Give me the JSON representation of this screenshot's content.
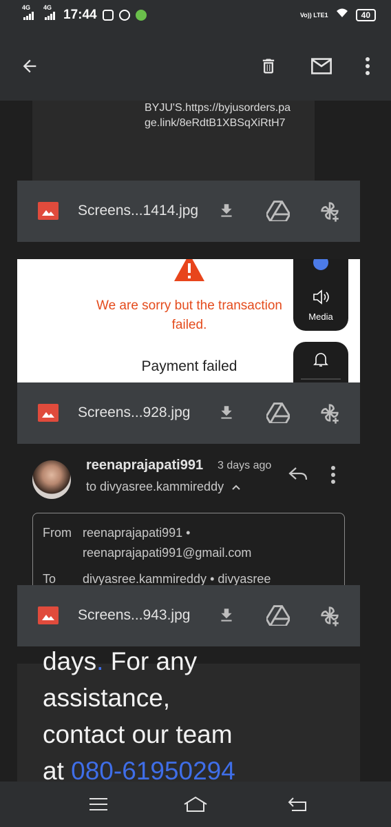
{
  "status_bar": {
    "network1": "4G",
    "network2": "4G",
    "time": "17:44",
    "volte": "Vo)) LTE1",
    "battery": "40"
  },
  "app_bar": {
    "back_icon": "arrow-left-icon",
    "delete_icon": "trash-icon",
    "mark_unread_icon": "envelope-icon",
    "more_icon": "more-vert-icon"
  },
  "message1": {
    "link_text": "BYJU'S.https://byjusorders.page.link/8eRdtB1XBSqXiRtH7"
  },
  "attachments": [
    {
      "filename": "Screens...1414.jpg"
    },
    {
      "filename": "Screens...928.jpg"
    },
    {
      "filename": "Screens...943.jpg"
    }
  ],
  "preview": {
    "fail_message": "We are sorry but the transaction failed.",
    "title": "Payment failed"
  },
  "volume_panel": {
    "media_label": "Media"
  },
  "sender": {
    "name": "reenaprajapati991",
    "time": "3 days ago",
    "to_line": "to divyasree.kammireddy",
    "from_label": "From",
    "from_name": "reenaprajapati991 •",
    "from_email": "reenaprajapati991@gmail.com",
    "to_label": "To",
    "to_value": "divyasree.kammireddy • divyasree"
  },
  "body_text": {
    "line1": "days",
    "dot": ".",
    "line1b": " For any",
    "line2": "assistance,",
    "line3": "contact our team",
    "line4": "at ",
    "phone": "080-61950294"
  }
}
